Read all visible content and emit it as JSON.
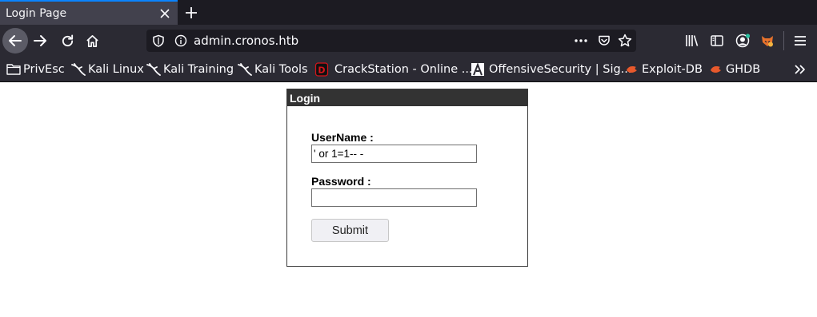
{
  "browser": {
    "tab": {
      "title": "Login Page"
    },
    "url": "admin.cronos.htb",
    "bookmarks": [
      {
        "label": "PrivEsc",
        "icon": "folder-icon"
      },
      {
        "label": "Kali Linux",
        "icon": "kali-dragon-icon"
      },
      {
        "label": "Kali Training",
        "icon": "kali-dragon-icon"
      },
      {
        "label": "Kali Tools",
        "icon": "kali-dragon-icon"
      },
      {
        "label": "CrackStation - Online ...",
        "icon": "crackstation-icon"
      },
      {
        "label": "OffensiveSecurity | Sig...",
        "icon": "offsec-icon"
      },
      {
        "label": "Exploit-DB",
        "icon": "exploitdb-icon"
      },
      {
        "label": "GHDB",
        "icon": "ghdb-icon"
      }
    ]
  },
  "page": {
    "login": {
      "header": "Login",
      "username_label": "UserName :",
      "username_value": "' or 1=1-- -",
      "password_label": "Password :",
      "password_value": "",
      "submit_label": "Submit"
    }
  },
  "colors": {
    "tab_accent": "#0a84ff",
    "chrome_dark": "#1c1b22",
    "chrome": "#2b2a33",
    "login_header_bg": "#333333"
  }
}
